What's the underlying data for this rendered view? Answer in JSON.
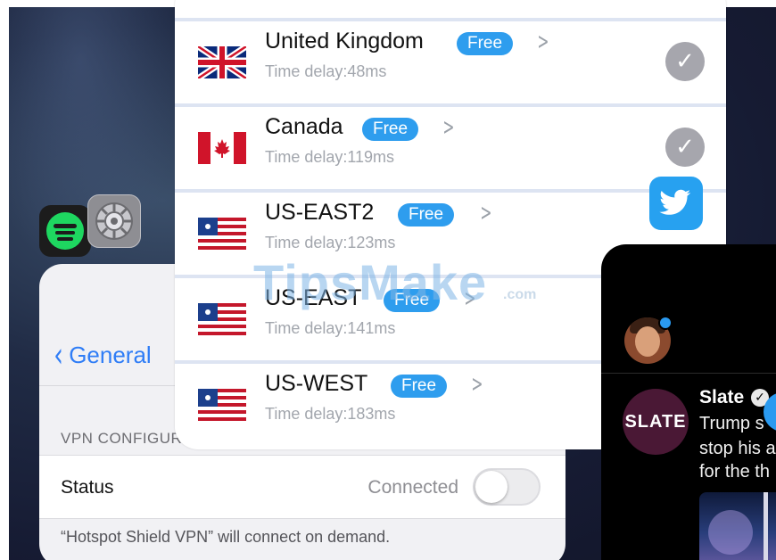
{
  "colors": {
    "vpn_row_separator": "#dde4f2",
    "free_badge_bg": "#2e9dee",
    "ios_link_blue": "#2f7df6",
    "twitter_blue": "#27a1f0",
    "slate_brand": "#4a1835"
  },
  "home_screen": {
    "icons": [
      {
        "name": "spotify-app-icon"
      },
      {
        "name": "settings-app-icon"
      },
      {
        "name": "twitter-app-icon"
      }
    ]
  },
  "vpn_list": {
    "rows": [
      {
        "country": "United Kingdom",
        "badge": "Free",
        "delay": "Time delay:48ms",
        "flag": "uk-flag-icon",
        "selected": true
      },
      {
        "country": "Canada",
        "badge": "Free",
        "delay": "Time delay:119ms",
        "flag": "canada-flag-icon",
        "selected": true
      },
      {
        "country": "US-EAST2",
        "badge": "Free",
        "delay": "Time delay:123ms",
        "flag": "us-flag-icon",
        "selected": true
      },
      {
        "country": "US-EAST",
        "badge": "Free",
        "delay": "Time delay:141ms",
        "flag": "us-flag-icon",
        "selected": false
      },
      {
        "country": "US-WEST",
        "badge": "Free",
        "delay": "Time delay:183ms",
        "flag": "us-flag-icon",
        "selected": false
      }
    ],
    "chevron_glyph": ">",
    "check_glyph": "✓"
  },
  "settings": {
    "back_label": "General",
    "section_header": "VPN CONFIGURA",
    "status_label": "Status",
    "status_value": "Connected",
    "toggle_on": false,
    "footer_note": "“Hotspot Shield VPN” will connect on demand."
  },
  "twitter": {
    "account_name": "Slate",
    "account_logo_text": "SLATE",
    "tweet_lines": [
      "Trump s",
      "stop his a",
      "for the th"
    ]
  },
  "watermark": {
    "text": "TipsMake",
    "suffix": ".com"
  }
}
